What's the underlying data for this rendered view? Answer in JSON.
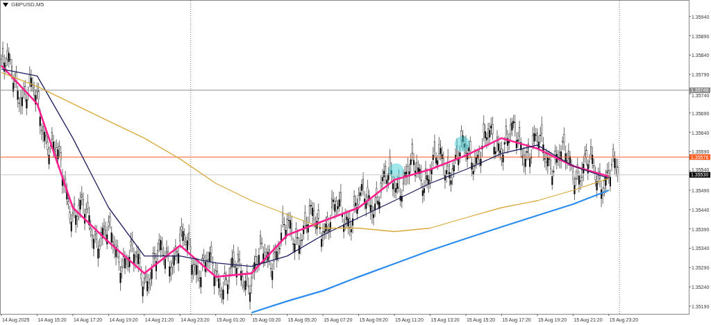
{
  "chart": {
    "title": "GBPUSD,M5",
    "chart_data": {
      "type": "line",
      "categories": [
        "14 Aug 2025",
        "14 Aug 15:20",
        "14 Aug 17:20",
        "14 Aug 19:20",
        "14 Aug 21:20",
        "14 Aug 23:20",
        "15 Aug 01:20",
        "15 Aug 03:20",
        "15 Aug 05:20",
        "15 Aug 07:20",
        "15 Aug 09:20",
        "15 Aug 11:20",
        "15 Aug 13:20",
        "15 Aug 15:20",
        "15 Aug 17:20",
        "15 Aug 19:20",
        "15 Aug 21:20",
        "15 Aug 23:20"
      ],
      "series": [
        {
          "color": "#ff1f8e",
          "values": [
            1.35813,
            1.35714,
            1.35445,
            1.35356,
            1.35275,
            1.35347,
            1.35266,
            1.35275,
            1.35374,
            1.3541,
            1.35445,
            1.35517,
            1.35544,
            1.3558,
            1.35625,
            1.35598,
            1.35553,
            1.35526
          ]
        },
        {
          "color": "#1c1c5e",
          "values": [
            1.35804,
            1.35786,
            1.35625,
            1.35445,
            1.3532,
            1.3532,
            1.35302,
            1.35293,
            1.3532,
            1.35374,
            1.35419,
            1.35463,
            1.35508,
            1.35544,
            1.35585,
            1.35607,
            1.35553,
            1.35521
          ]
        },
        {
          "color": "#d9a93a",
          "values": [
            1.35795,
            1.35759,
            1.35714,
            1.35669,
            1.35625,
            1.35571,
            1.35508,
            1.35463,
            1.35427,
            1.35392,
            1.35392,
            1.35383,
            1.35392,
            1.35419,
            1.35445,
            1.35463,
            1.3549,
            1.35521
          ]
        },
        {
          "color": "#2a8cf0",
          "values": [
            null,
            null,
            null,
            null,
            null,
            null,
            null,
            1.35173,
            1.35203,
            1.3523,
            1.35266,
            1.353,
            1.35334,
            1.35365,
            1.35395,
            1.35425,
            1.35454,
            1.3549
          ]
        }
      ],
      "ylim": [
        1.3517,
        1.35979
      ],
      "yticks": [
        {
          "value": 1.3594,
          "label": "1.35940"
        },
        {
          "value": 1.3589,
          "label": "1.35890"
        },
        {
          "value": 1.3584,
          "label": "1.35840"
        },
        {
          "value": 1.3579,
          "label": "1.35790"
        },
        {
          "value": 1.3574,
          "label": "1.35740"
        },
        {
          "value": 1.3569,
          "label": "1.35690"
        },
        {
          "value": 1.3564,
          "label": "1.35640"
        },
        {
          "value": 1.3559,
          "label": "1.35590"
        },
        {
          "value": 1.3554,
          "label": "1.35540"
        },
        {
          "value": 1.3549,
          "label": "1.35490"
        },
        {
          "value": 1.3544,
          "label": "1.35440"
        },
        {
          "value": 1.3539,
          "label": "1.35390"
        },
        {
          "value": 1.3534,
          "label": "1.35340"
        },
        {
          "value": 1.3529,
          "label": "1.35290"
        },
        {
          "value": 1.3524,
          "label": "1.35240"
        },
        {
          "value": 1.3519,
          "label": "1.35190"
        }
      ],
      "ref_lines": [
        {
          "axis": "y",
          "value": 1.35749,
          "color": "#8c8c8c"
        },
        {
          "axis": "y",
          "value": 1.35576,
          "color": "#ff5a1f"
        },
        {
          "axis": "y",
          "value": 1.3553,
          "color": "#c8c8c8"
        }
      ]
    },
    "price_tags": [
      {
        "label": "1.35749",
        "color": "#8c8c8c"
      },
      {
        "label": "1.35576",
        "color": "#ff5a1f"
      },
      {
        "label": "1.35530",
        "color": "#000000"
      }
    ]
  }
}
